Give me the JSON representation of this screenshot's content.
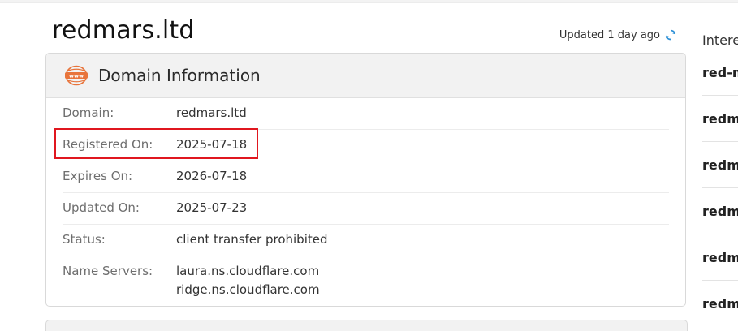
{
  "page": {
    "title": "redmars.ltd",
    "updated_text": "Updated 1 day ago"
  },
  "card": {
    "icon_text": "www",
    "title": "Domain Information",
    "rows": [
      {
        "label": "Domain:",
        "value": "redmars.ltd"
      },
      {
        "label": "Registered On:",
        "value": "2025-07-18"
      },
      {
        "label": "Expires On:",
        "value": "2026-07-18"
      },
      {
        "label": "Updated On:",
        "value": "2025-07-23"
      },
      {
        "label": "Status:",
        "value": "client transfer prohibited"
      },
      {
        "label": "Name Servers:",
        "value": "laura.ns.cloudflare.com",
        "value2": "ridge.ns.cloudflare.com"
      }
    ]
  },
  "sidebar": {
    "title": "Intere",
    "items": [
      "red-m",
      "redma",
      "redma",
      "redma",
      "redma",
      "redma"
    ]
  },
  "colors": {
    "accent_orange": "#e8743b",
    "refresh_blue": "#2b8fd6",
    "highlight_red": "#e0171f"
  }
}
